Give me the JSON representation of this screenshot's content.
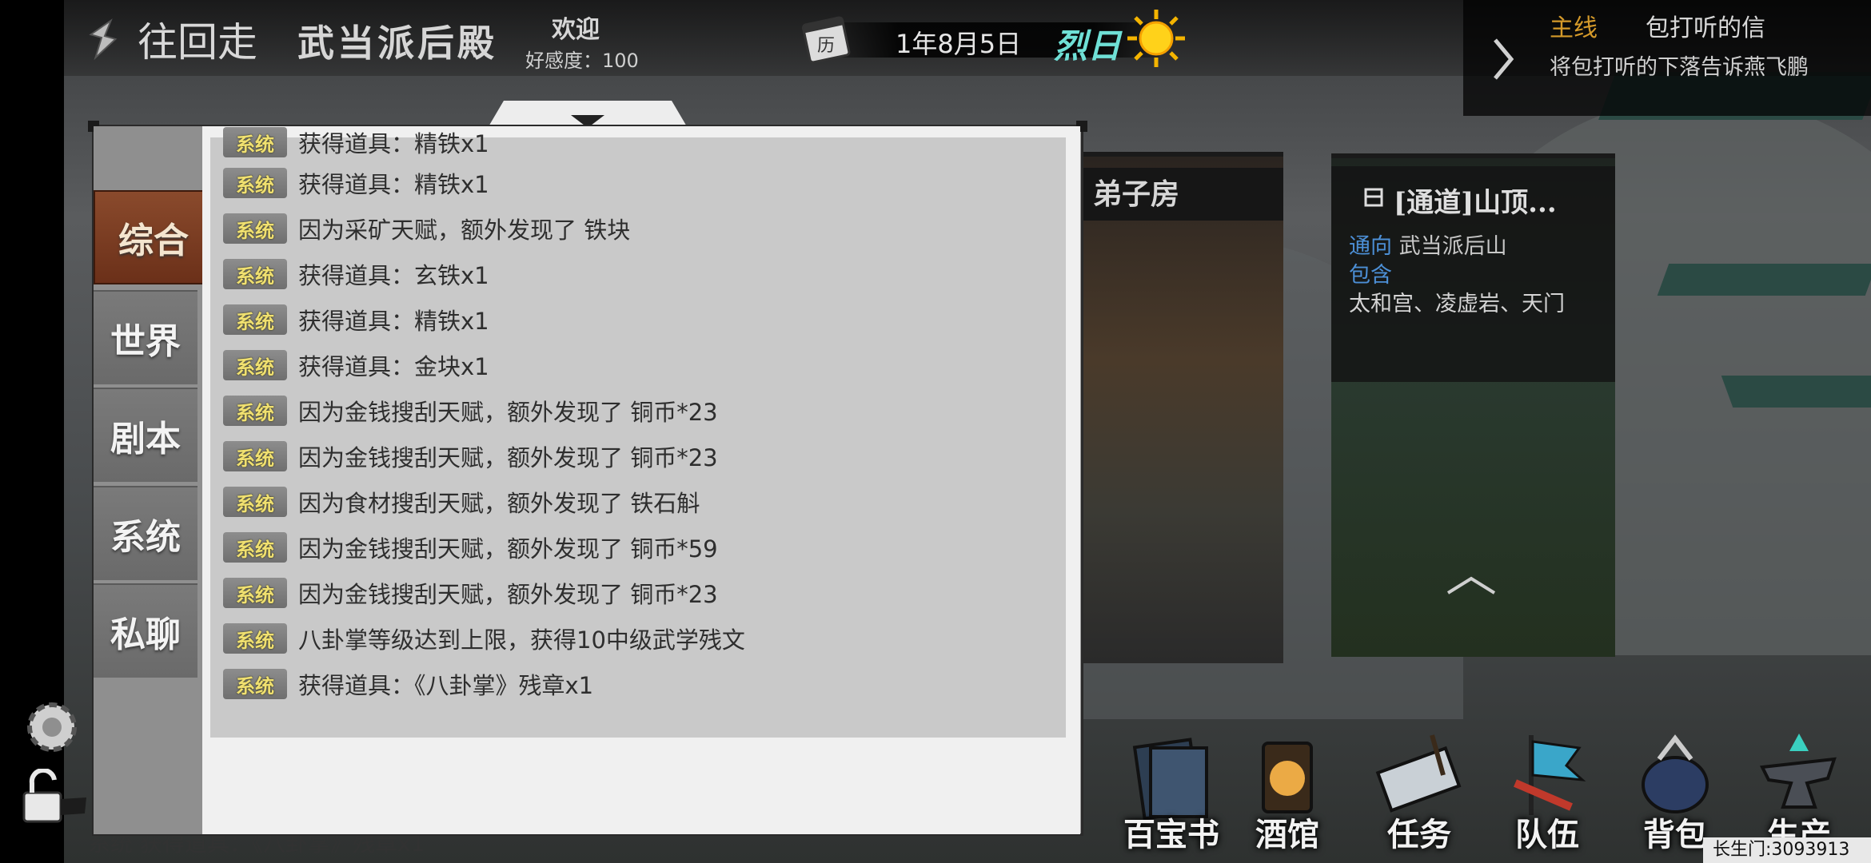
{
  "header": {
    "back_label": "往回走",
    "location": "武当派后殿",
    "welcome": "欢迎",
    "favor": "好感度：100",
    "date": "1年8月5日",
    "weather": "烈日",
    "calendar_glyph": "历"
  },
  "quest": {
    "tag": "主线",
    "name": "包打听的信",
    "desc": "将包打听的下落告诉燕飞鹏"
  },
  "cards": {
    "first_title": "弟子房",
    "second_title": "[通道]山顶...",
    "leads_label": "通向",
    "leads_value": "武当派后山",
    "contains_label": "包含",
    "contains_value": "太和宫、凌虚岩、天门"
  },
  "tabs": [
    {
      "label": "综合",
      "active": true
    },
    {
      "label": "世界",
      "active": false
    },
    {
      "label": "剧本",
      "active": false
    },
    {
      "label": "系统",
      "active": false
    },
    {
      "label": "私聊",
      "active": false
    }
  ],
  "messages": [
    {
      "tag": "系统",
      "text": "获得道具：精铁x1"
    },
    {
      "tag": "系统",
      "text": "获得道具：精铁x1"
    },
    {
      "tag": "系统",
      "text": "因为采矿天赋，额外发现了 铁块"
    },
    {
      "tag": "系统",
      "text": "获得道具：玄铁x1"
    },
    {
      "tag": "系统",
      "text": "获得道具：精铁x1"
    },
    {
      "tag": "系统",
      "text": "获得道具：金块x1"
    },
    {
      "tag": "系统",
      "text": "因为金钱搜刮天赋，额外发现了 铜币*23"
    },
    {
      "tag": "系统",
      "text": "因为金钱搜刮天赋，额外发现了 铜币*23"
    },
    {
      "tag": "系统",
      "text": "因为食材搜刮天赋，额外发现了 铁石斛"
    },
    {
      "tag": "系统",
      "text": "因为金钱搜刮天赋，额外发现了 铜币*59"
    },
    {
      "tag": "系统",
      "text": "因为金钱搜刮天赋，额外发现了 铜币*23"
    },
    {
      "tag": "系统",
      "text": "八卦掌等级达到上限，获得10中级武学残文"
    },
    {
      "tag": "系统",
      "text": "获得道具：《八卦掌》残章x1"
    }
  ],
  "bottom_log": "系统  获得道具：《八卦掌》残章x1",
  "menu": [
    {
      "label": "百宝书",
      "icon": "book-icon"
    },
    {
      "label": "酒馆",
      "icon": "lantern-icon"
    },
    {
      "label": "任务",
      "icon": "scroll-icon"
    },
    {
      "label": "队伍",
      "icon": "flag-icon"
    },
    {
      "label": "背包",
      "icon": "bag-icon"
    },
    {
      "label": "生产",
      "icon": "anvil-icon"
    }
  ],
  "server": "长生门:3093913",
  "colors": {
    "active_tab": "#7a3a20",
    "quest_tag": "#d59a2a",
    "weather": "#6fe0d6",
    "link_blue": "#4c8fd6",
    "system_tag_text": "#f0e070"
  }
}
